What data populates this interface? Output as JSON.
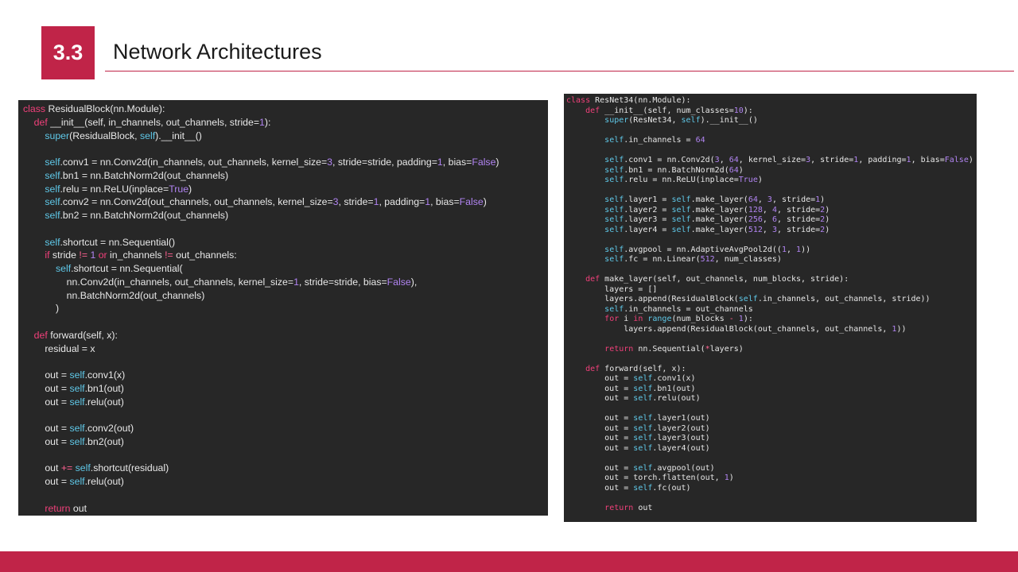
{
  "header": {
    "section_number": "3.3",
    "title": "Network Architectures"
  },
  "colors": {
    "accent": "#c02448",
    "code_bg": "#272727",
    "code_text": "#e8e8e8",
    "keyword": "#f0407a",
    "number": "#b184f2",
    "self": "#5fc8e8",
    "operator": "#ff6090"
  },
  "code_left": {
    "lines": [
      [
        [
          "k",
          "class"
        ],
        [
          "t",
          " ResidualBlock(nn.Module):"
        ]
      ],
      [
        [
          "t",
          "    "
        ],
        [
          "k",
          "def"
        ],
        [
          "t",
          " __init__(self, in_channels, out_channels, stride="
        ],
        [
          "n",
          "1"
        ],
        [
          "t",
          "):"
        ]
      ],
      [
        [
          "t",
          "        "
        ],
        [
          "s",
          "super"
        ],
        [
          "t",
          "(ResidualBlock, "
        ],
        [
          "s",
          "self"
        ],
        [
          "t",
          ").__init__()"
        ]
      ],
      [
        [
          "t",
          ""
        ]
      ],
      [
        [
          "t",
          "        "
        ],
        [
          "s",
          "self"
        ],
        [
          "t",
          ".conv1 = nn.Conv2d(in_channels, out_channels, kernel_size="
        ],
        [
          "n",
          "3"
        ],
        [
          "t",
          ", stride=stride, padding="
        ],
        [
          "n",
          "1"
        ],
        [
          "t",
          ", bias="
        ],
        [
          "n",
          "False"
        ],
        [
          "t",
          ")"
        ]
      ],
      [
        [
          "t",
          "        "
        ],
        [
          "s",
          "self"
        ],
        [
          "t",
          ".bn1 = nn.BatchNorm2d(out_channels)"
        ]
      ],
      [
        [
          "t",
          "        "
        ],
        [
          "s",
          "self"
        ],
        [
          "t",
          ".relu = nn.ReLU(inplace="
        ],
        [
          "n",
          "True"
        ],
        [
          "t",
          ")"
        ]
      ],
      [
        [
          "t",
          "        "
        ],
        [
          "s",
          "self"
        ],
        [
          "t",
          ".conv2 = nn.Conv2d(out_channels, out_channels, kernel_size="
        ],
        [
          "n",
          "3"
        ],
        [
          "t",
          ", stride="
        ],
        [
          "n",
          "1"
        ],
        [
          "t",
          ", padding="
        ],
        [
          "n",
          "1"
        ],
        [
          "t",
          ", bias="
        ],
        [
          "n",
          "False"
        ],
        [
          "t",
          ")"
        ]
      ],
      [
        [
          "t",
          "        "
        ],
        [
          "s",
          "self"
        ],
        [
          "t",
          ".bn2 = nn.BatchNorm2d(out_channels)"
        ]
      ],
      [
        [
          "t",
          ""
        ]
      ],
      [
        [
          "t",
          "        "
        ],
        [
          "s",
          "self"
        ],
        [
          "t",
          ".shortcut = nn.Sequential()"
        ]
      ],
      [
        [
          "t",
          "        "
        ],
        [
          "k",
          "if"
        ],
        [
          "t",
          " stride "
        ],
        [
          "o",
          "!="
        ],
        [
          "t",
          " "
        ],
        [
          "n",
          "1"
        ],
        [
          "t",
          " "
        ],
        [
          "k",
          "or"
        ],
        [
          "t",
          " in_channels "
        ],
        [
          "o",
          "!="
        ],
        [
          "t",
          " out_channels:"
        ]
      ],
      [
        [
          "t",
          "            "
        ],
        [
          "s",
          "self"
        ],
        [
          "t",
          ".shortcut = nn.Sequential("
        ]
      ],
      [
        [
          "t",
          "                nn.Conv2d(in_channels, out_channels, kernel_size="
        ],
        [
          "n",
          "1"
        ],
        [
          "t",
          ", stride=stride, bias="
        ],
        [
          "n",
          "False"
        ],
        [
          "t",
          "),"
        ]
      ],
      [
        [
          "t",
          "                nn.BatchNorm2d(out_channels)"
        ]
      ],
      [
        [
          "t",
          "            )"
        ]
      ],
      [
        [
          "t",
          ""
        ]
      ],
      [
        [
          "t",
          "    "
        ],
        [
          "k",
          "def"
        ],
        [
          "t",
          " forward(self, x):"
        ]
      ],
      [
        [
          "t",
          "        residual = x"
        ]
      ],
      [
        [
          "t",
          ""
        ]
      ],
      [
        [
          "t",
          "        out = "
        ],
        [
          "s",
          "self"
        ],
        [
          "t",
          ".conv1(x)"
        ]
      ],
      [
        [
          "t",
          "        out = "
        ],
        [
          "s",
          "self"
        ],
        [
          "t",
          ".bn1(out)"
        ]
      ],
      [
        [
          "t",
          "        out = "
        ],
        [
          "s",
          "self"
        ],
        [
          "t",
          ".relu(out)"
        ]
      ],
      [
        [
          "t",
          ""
        ]
      ],
      [
        [
          "t",
          "        out = "
        ],
        [
          "s",
          "self"
        ],
        [
          "t",
          ".conv2(out)"
        ]
      ],
      [
        [
          "t",
          "        out = "
        ],
        [
          "s",
          "self"
        ],
        [
          "t",
          ".bn2(out)"
        ]
      ],
      [
        [
          "t",
          ""
        ]
      ],
      [
        [
          "t",
          "        out "
        ],
        [
          "o",
          "+="
        ],
        [
          "t",
          " "
        ],
        [
          "s",
          "self"
        ],
        [
          "t",
          ".shortcut(residual)"
        ]
      ],
      [
        [
          "t",
          "        out = "
        ],
        [
          "s",
          "self"
        ],
        [
          "t",
          ".relu(out)"
        ]
      ],
      [
        [
          "t",
          ""
        ]
      ],
      [
        [
          "t",
          "        "
        ],
        [
          "k",
          "return"
        ],
        [
          "t",
          " out"
        ]
      ]
    ]
  },
  "code_right": {
    "lines": [
      [
        [
          "k",
          "class"
        ],
        [
          "t",
          " ResNet34(nn.Module):"
        ]
      ],
      [
        [
          "t",
          "    "
        ],
        [
          "k",
          "def"
        ],
        [
          "t",
          " __init__(self, num_classes="
        ],
        [
          "n",
          "10"
        ],
        [
          "t",
          "):"
        ]
      ],
      [
        [
          "t",
          "        "
        ],
        [
          "s",
          "super"
        ],
        [
          "t",
          "(ResNet34, "
        ],
        [
          "s",
          "self"
        ],
        [
          "t",
          ").__init__()"
        ]
      ],
      [
        [
          "t",
          ""
        ]
      ],
      [
        [
          "t",
          "        "
        ],
        [
          "s",
          "self"
        ],
        [
          "t",
          ".in_channels = "
        ],
        [
          "n",
          "64"
        ]
      ],
      [
        [
          "t",
          ""
        ]
      ],
      [
        [
          "t",
          "        "
        ],
        [
          "s",
          "self"
        ],
        [
          "t",
          ".conv1 = nn.Conv2d("
        ],
        [
          "n",
          "3"
        ],
        [
          "t",
          ", "
        ],
        [
          "n",
          "64"
        ],
        [
          "t",
          ", kernel_size="
        ],
        [
          "n",
          "3"
        ],
        [
          "t",
          ", stride="
        ],
        [
          "n",
          "1"
        ],
        [
          "t",
          ", padding="
        ],
        [
          "n",
          "1"
        ],
        [
          "t",
          ", bias="
        ],
        [
          "n",
          "False"
        ],
        [
          "t",
          ")"
        ]
      ],
      [
        [
          "t",
          "        "
        ],
        [
          "s",
          "self"
        ],
        [
          "t",
          ".bn1 = nn.BatchNorm2d("
        ],
        [
          "n",
          "64"
        ],
        [
          "t",
          ")"
        ]
      ],
      [
        [
          "t",
          "        "
        ],
        [
          "s",
          "self"
        ],
        [
          "t",
          ".relu = nn.ReLU(inplace="
        ],
        [
          "n",
          "True"
        ],
        [
          "t",
          ")"
        ]
      ],
      [
        [
          "t",
          ""
        ]
      ],
      [
        [
          "t",
          "        "
        ],
        [
          "s",
          "self"
        ],
        [
          "t",
          ".layer1 = "
        ],
        [
          "s",
          "self"
        ],
        [
          "t",
          ".make_layer("
        ],
        [
          "n",
          "64"
        ],
        [
          "t",
          ", "
        ],
        [
          "n",
          "3"
        ],
        [
          "t",
          ", stride="
        ],
        [
          "n",
          "1"
        ],
        [
          "t",
          ")"
        ]
      ],
      [
        [
          "t",
          "        "
        ],
        [
          "s",
          "self"
        ],
        [
          "t",
          ".layer2 = "
        ],
        [
          "s",
          "self"
        ],
        [
          "t",
          ".make_layer("
        ],
        [
          "n",
          "128"
        ],
        [
          "t",
          ", "
        ],
        [
          "n",
          "4"
        ],
        [
          "t",
          ", stride="
        ],
        [
          "n",
          "2"
        ],
        [
          "t",
          ")"
        ]
      ],
      [
        [
          "t",
          "        "
        ],
        [
          "s",
          "self"
        ],
        [
          "t",
          ".layer3 = "
        ],
        [
          "s",
          "self"
        ],
        [
          "t",
          ".make_layer("
        ],
        [
          "n",
          "256"
        ],
        [
          "t",
          ", "
        ],
        [
          "n",
          "6"
        ],
        [
          "t",
          ", stride="
        ],
        [
          "n",
          "2"
        ],
        [
          "t",
          ")"
        ]
      ],
      [
        [
          "t",
          "        "
        ],
        [
          "s",
          "self"
        ],
        [
          "t",
          ".layer4 = "
        ],
        [
          "s",
          "self"
        ],
        [
          "t",
          ".make_layer("
        ],
        [
          "n",
          "512"
        ],
        [
          "t",
          ", "
        ],
        [
          "n",
          "3"
        ],
        [
          "t",
          ", stride="
        ],
        [
          "n",
          "2"
        ],
        [
          "t",
          ")"
        ]
      ],
      [
        [
          "t",
          ""
        ]
      ],
      [
        [
          "t",
          "        "
        ],
        [
          "s",
          "self"
        ],
        [
          "t",
          ".avgpool = nn.AdaptiveAvgPool2d(("
        ],
        [
          "n",
          "1"
        ],
        [
          "t",
          ", "
        ],
        [
          "n",
          "1"
        ],
        [
          "t",
          "))"
        ]
      ],
      [
        [
          "t",
          "        "
        ],
        [
          "s",
          "self"
        ],
        [
          "t",
          ".fc = nn.Linear("
        ],
        [
          "n",
          "512"
        ],
        [
          "t",
          ", num_classes)"
        ]
      ],
      [
        [
          "t",
          ""
        ]
      ],
      [
        [
          "t",
          "    "
        ],
        [
          "k",
          "def"
        ],
        [
          "t",
          " make_layer(self, out_channels, num_blocks, stride):"
        ]
      ],
      [
        [
          "t",
          "        layers = []"
        ]
      ],
      [
        [
          "t",
          "        layers.append(ResidualBlock("
        ],
        [
          "s",
          "self"
        ],
        [
          "t",
          ".in_channels, out_channels, stride))"
        ]
      ],
      [
        [
          "t",
          "        "
        ],
        [
          "s",
          "self"
        ],
        [
          "t",
          ".in_channels = out_channels"
        ]
      ],
      [
        [
          "t",
          "        "
        ],
        [
          "k",
          "for"
        ],
        [
          "t",
          " i "
        ],
        [
          "k",
          "in"
        ],
        [
          "t",
          " "
        ],
        [
          "s",
          "range"
        ],
        [
          "t",
          "(num_blocks "
        ],
        [
          "o",
          "-"
        ],
        [
          "t",
          " "
        ],
        [
          "n",
          "1"
        ],
        [
          "t",
          "):"
        ]
      ],
      [
        [
          "t",
          "            layers.append(ResidualBlock(out_channels, out_channels, "
        ],
        [
          "n",
          "1"
        ],
        [
          "t",
          "))"
        ]
      ],
      [
        [
          "t",
          ""
        ]
      ],
      [
        [
          "t",
          "        "
        ],
        [
          "k",
          "return"
        ],
        [
          "t",
          " nn.Sequential("
        ],
        [
          "o",
          "*"
        ],
        [
          "t",
          "layers)"
        ]
      ],
      [
        [
          "t",
          ""
        ]
      ],
      [
        [
          "t",
          "    "
        ],
        [
          "k",
          "def"
        ],
        [
          "t",
          " forward(self, x):"
        ]
      ],
      [
        [
          "t",
          "        out = "
        ],
        [
          "s",
          "self"
        ],
        [
          "t",
          ".conv1(x)"
        ]
      ],
      [
        [
          "t",
          "        out = "
        ],
        [
          "s",
          "self"
        ],
        [
          "t",
          ".bn1(out)"
        ]
      ],
      [
        [
          "t",
          "        out = "
        ],
        [
          "s",
          "self"
        ],
        [
          "t",
          ".relu(out)"
        ]
      ],
      [
        [
          "t",
          ""
        ]
      ],
      [
        [
          "t",
          "        out = "
        ],
        [
          "s",
          "self"
        ],
        [
          "t",
          ".layer1(out)"
        ]
      ],
      [
        [
          "t",
          "        out = "
        ],
        [
          "s",
          "self"
        ],
        [
          "t",
          ".layer2(out)"
        ]
      ],
      [
        [
          "t",
          "        out = "
        ],
        [
          "s",
          "self"
        ],
        [
          "t",
          ".layer3(out)"
        ]
      ],
      [
        [
          "t",
          "        out = "
        ],
        [
          "s",
          "self"
        ],
        [
          "t",
          ".layer4(out)"
        ]
      ],
      [
        [
          "t",
          ""
        ]
      ],
      [
        [
          "t",
          "        out = "
        ],
        [
          "s",
          "self"
        ],
        [
          "t",
          ".avgpool(out)"
        ]
      ],
      [
        [
          "t",
          "        out = torch.flatten(out, "
        ],
        [
          "n",
          "1"
        ],
        [
          "t",
          ")"
        ]
      ],
      [
        [
          "t",
          "        out = "
        ],
        [
          "s",
          "self"
        ],
        [
          "t",
          ".fc(out)"
        ]
      ],
      [
        [
          "t",
          ""
        ]
      ],
      [
        [
          "t",
          "        "
        ],
        [
          "k",
          "return"
        ],
        [
          "t",
          " out"
        ]
      ]
    ]
  }
}
